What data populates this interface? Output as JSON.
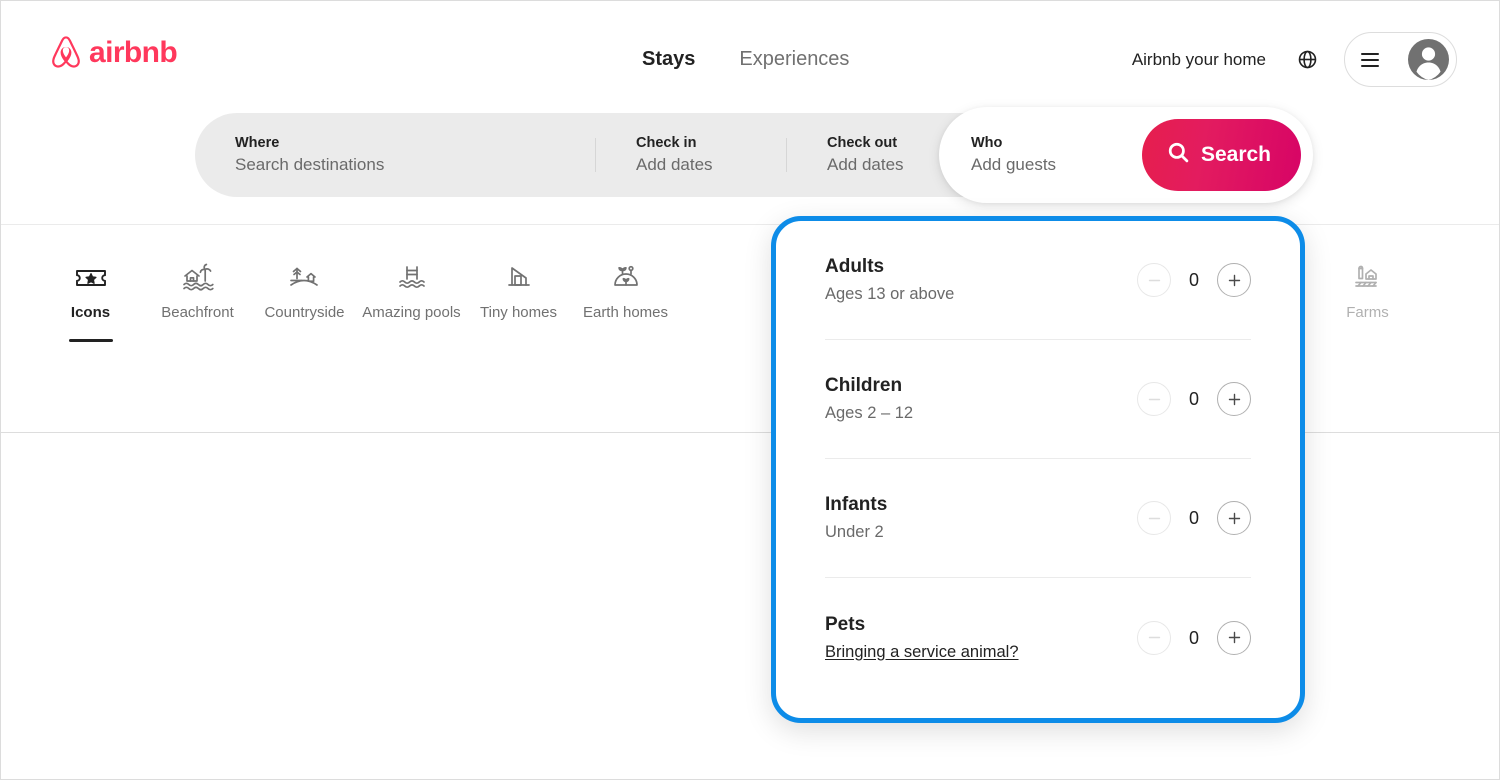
{
  "brand": {
    "name": "airbnb",
    "logo_icon": "airbnb-belo-icon",
    "accent_color": "#FF385C",
    "search_button_color": "#E31C5F",
    "highlight_color": "#0D8CE8"
  },
  "header": {
    "nav": [
      {
        "label": "Stays",
        "active": true
      },
      {
        "label": "Experiences",
        "active": false
      }
    ],
    "host_link": "Airbnb your home",
    "globe_icon": "globe-icon",
    "menu_icon": "hamburger-icon",
    "avatar_icon": "user-avatar-icon"
  },
  "search": {
    "where": {
      "label": "Where",
      "value": "Search destinations",
      "placeholder": "Search destinations"
    },
    "checkin": {
      "label": "Check in",
      "value": "Add dates",
      "placeholder": "Add dates"
    },
    "checkout": {
      "label": "Check out",
      "value": "Add dates",
      "placeholder": "Add dates"
    },
    "who": {
      "label": "Who",
      "value": "Add guests",
      "placeholder": "Add guests"
    },
    "search_button": {
      "label": "Search",
      "icon": "search-icon"
    }
  },
  "categories": {
    "items": [
      {
        "label": "Icons",
        "icon": "ticket-star-icon",
        "active": true
      },
      {
        "label": "Beachfront",
        "icon": "beach-hut-icon",
        "active": false
      },
      {
        "label": "Countryside",
        "icon": "countryside-icon",
        "active": false
      },
      {
        "label": "Amazing pools",
        "icon": "pool-icon",
        "active": false
      },
      {
        "label": "Tiny homes",
        "icon": "tiny-home-icon",
        "active": false
      },
      {
        "label": "Earth homes",
        "icon": "earth-home-icon",
        "active": false
      }
    ],
    "edge_item": {
      "label": "Farms",
      "icon": "farm-icon"
    },
    "next_button_icon": "chevron-right-icon"
  },
  "guest_panel": {
    "rows": [
      {
        "title": "Adults",
        "subtitle": "Ages 13 or above",
        "subtitle_is_link": false,
        "count": "0",
        "decrement_enabled": false,
        "increment_enabled": true
      },
      {
        "title": "Children",
        "subtitle": "Ages 2 – 12",
        "subtitle_is_link": false,
        "count": "0",
        "decrement_enabled": false,
        "increment_enabled": true
      },
      {
        "title": "Infants",
        "subtitle": "Under 2",
        "subtitle_is_link": false,
        "count": "0",
        "decrement_enabled": false,
        "increment_enabled": true
      },
      {
        "title": "Pets",
        "subtitle": "Bringing a service animal?",
        "subtitle_is_link": true,
        "count": "0",
        "decrement_enabled": false,
        "increment_enabled": true
      }
    ],
    "decrement_icon": "minus-icon",
    "increment_icon": "plus-icon"
  }
}
